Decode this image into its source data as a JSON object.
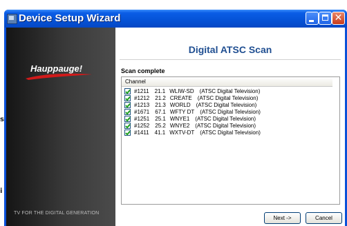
{
  "window": {
    "title": "Device Setup Wizard"
  },
  "titlebar_buttons": {
    "close_glyph": "✕"
  },
  "sidebar": {
    "brand": "Hauppauge!",
    "tagline": "TV FOR THE DIGITAL GENERATION"
  },
  "content": {
    "heading": "Digital ATSC Scan",
    "status": "Scan complete",
    "list_header": "Channel",
    "channels": [
      {
        "num": "#1211",
        "major": "21.1",
        "call": "WLIW-SD",
        "type": "(ATSC Digital Television)",
        "checked": true
      },
      {
        "num": "#1212",
        "major": "21.2",
        "call": "CREATE",
        "type": "(ATSC Digital Television)",
        "checked": true
      },
      {
        "num": "#1213",
        "major": "21.3",
        "call": "WORLD",
        "type": "(ATSC Digital Television)",
        "checked": true
      },
      {
        "num": "#1671",
        "major": "67.1",
        "call": "WFTY DT",
        "type": "(ATSC Digital Television)",
        "checked": true
      },
      {
        "num": "#1251",
        "major": "25.1",
        "call": "WNYE1",
        "type": "(ATSC Digital Television)",
        "checked": true
      },
      {
        "num": "#1252",
        "major": "25.2",
        "call": "WNYE2",
        "type": "(ATSC Digital Television)",
        "checked": true
      },
      {
        "num": "#1411",
        "major": "41.1",
        "call": "WXTV-DT",
        "type": "(ATSC Digital Television)",
        "checked": true
      }
    ]
  },
  "buttons": {
    "next": "Next ->",
    "cancel": "Cancel"
  },
  "background": {
    "glyph_top": "s",
    "glyph_bottom": "i"
  },
  "colors": {
    "titlebar": "#0553d8",
    "heading": "#1f4e91",
    "sidebar": "#2b2b2b",
    "close_button": "#c73b1a"
  }
}
